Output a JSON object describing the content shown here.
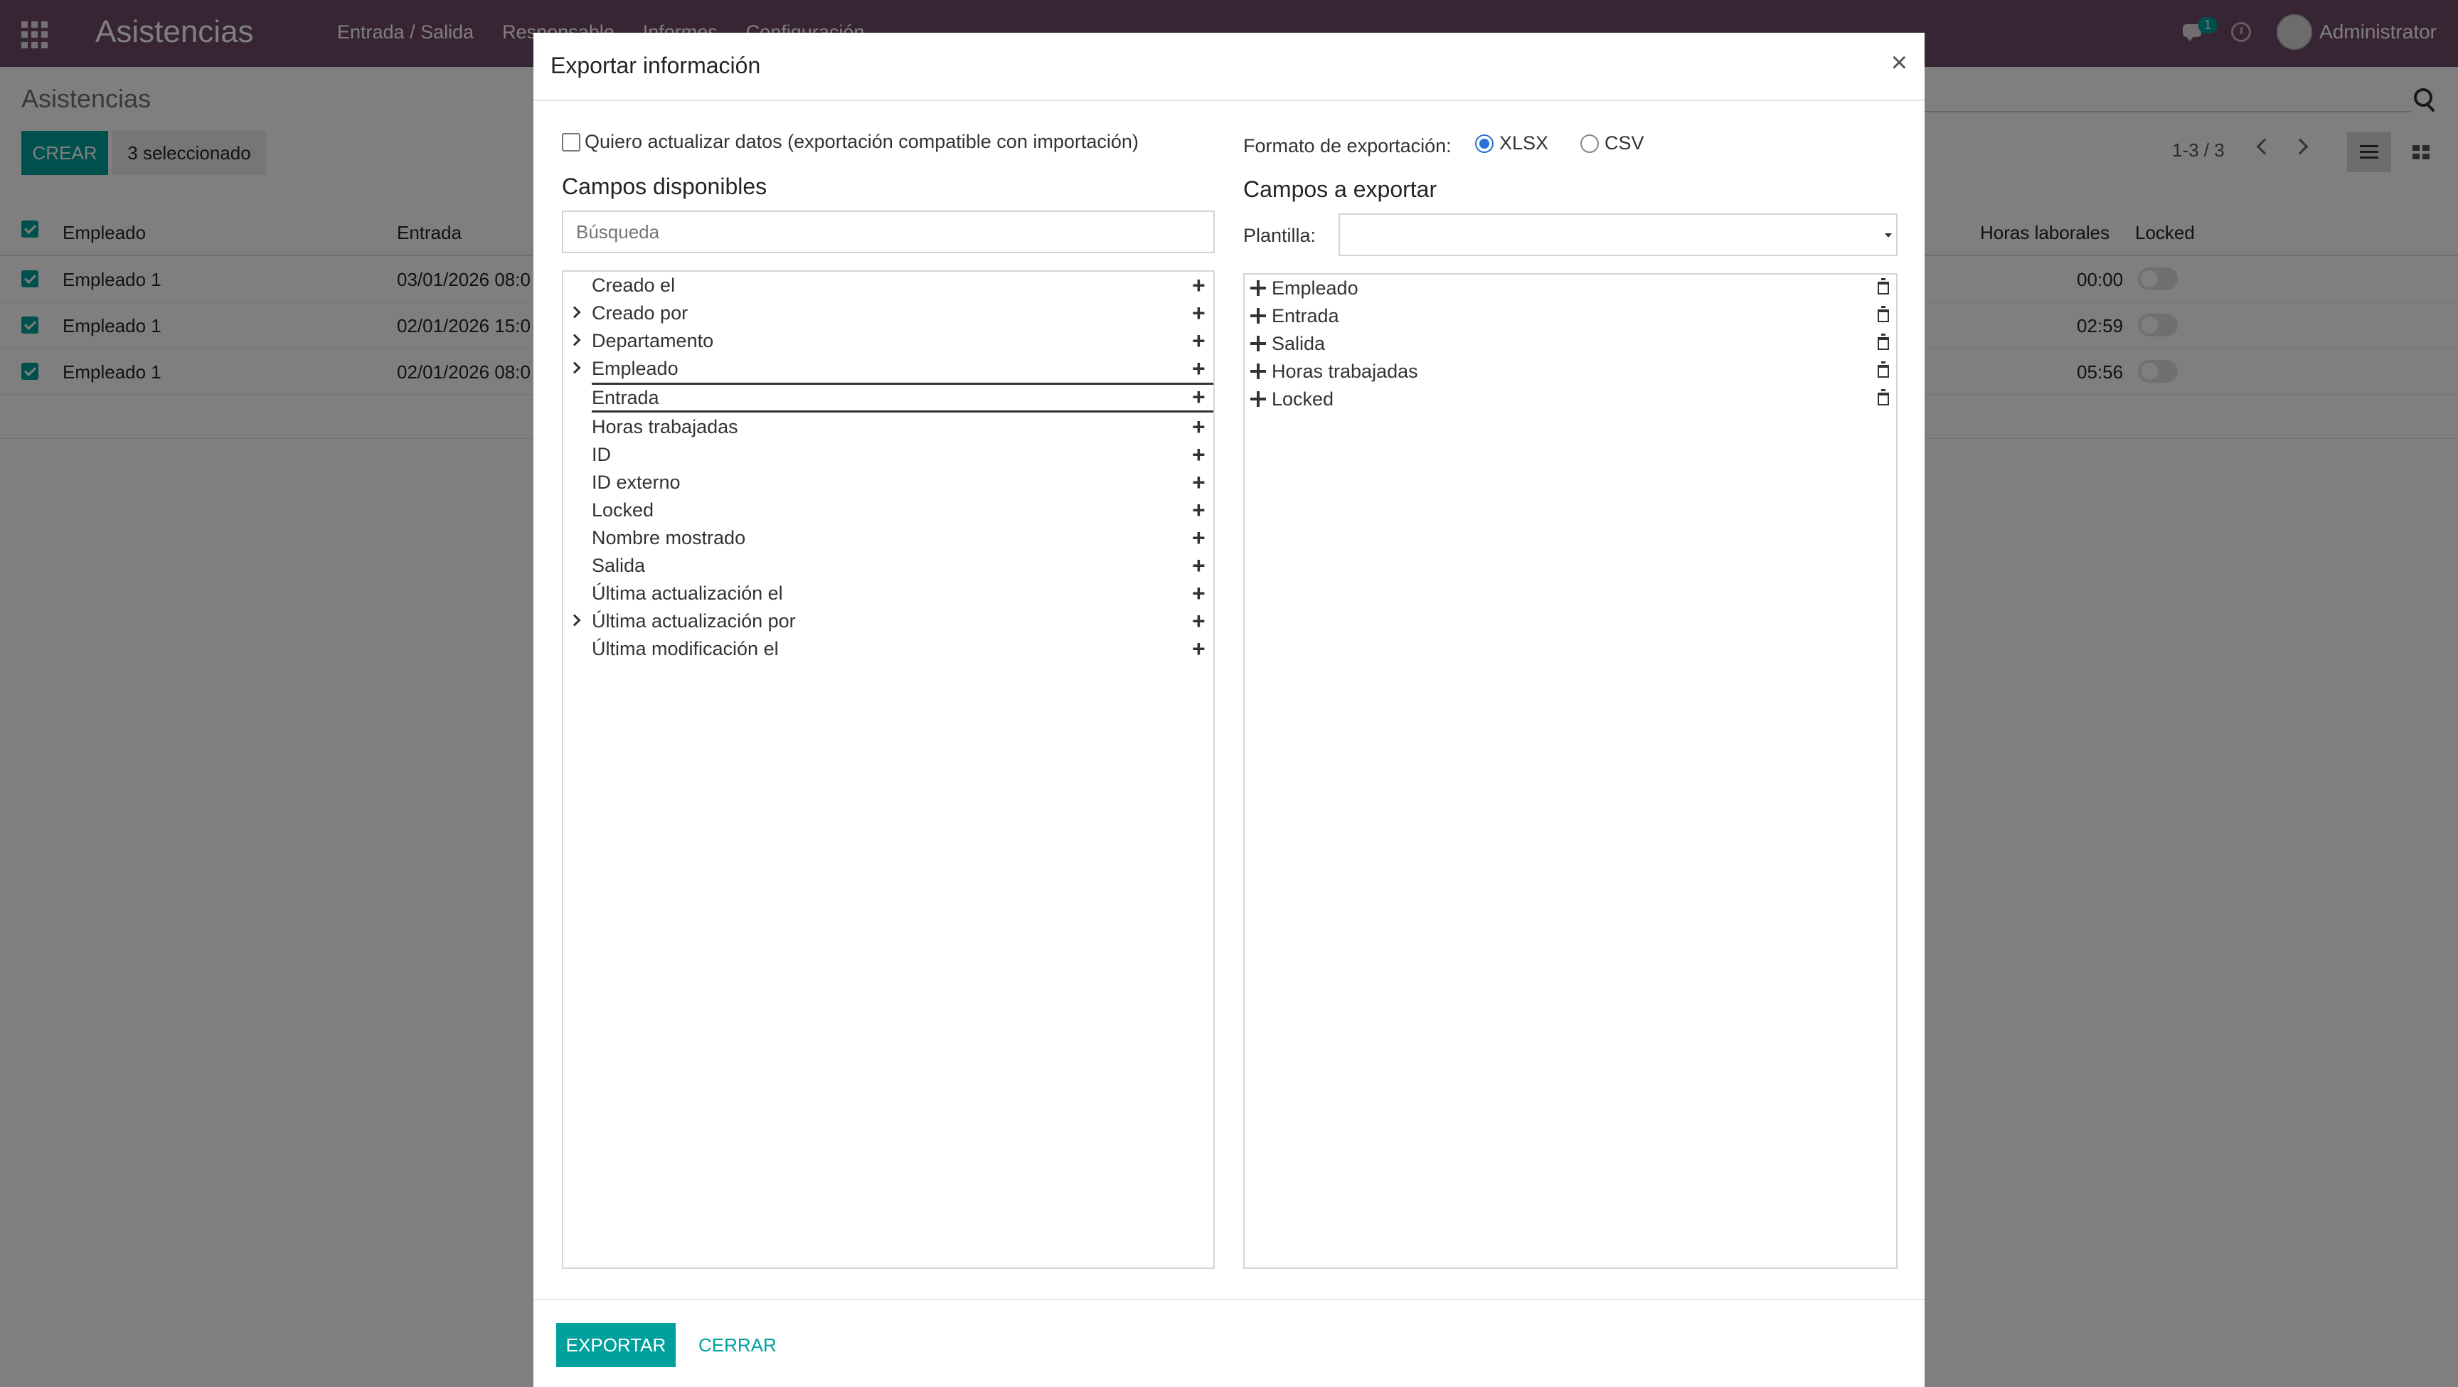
{
  "navbar": {
    "app_title": "Asistencias",
    "menu": [
      "Entrada / Salida",
      "Responsable",
      "Informes",
      "Configuración"
    ],
    "chat_badge": "1",
    "user_name": "Administrator"
  },
  "control_panel": {
    "title": "Asistencias",
    "create_label": "CREAR",
    "selected_label": "3 seleccionado",
    "pager": "1-3 / 3"
  },
  "list": {
    "headers": {
      "employee": "Empleado",
      "check_in": "Entrada",
      "worked_hours": "Horas laborales",
      "locked": "Locked"
    },
    "rows": [
      {
        "employee": "Empleado 1",
        "check_in": "03/01/2026 08:0",
        "worked_hours": "00:00"
      },
      {
        "employee": "Empleado 1",
        "check_in": "02/01/2026 15:0",
        "worked_hours": "02:59"
      },
      {
        "employee": "Empleado 1",
        "check_in": "02/01/2026 08:0",
        "worked_hours": "05:56"
      }
    ]
  },
  "modal": {
    "title": "Exportar información",
    "close_symbol": "×",
    "import_compat_label": "Quiero actualizar datos (exportación compatible con importación)",
    "format_label": "Formato de exportación:",
    "format_options": [
      "XLSX",
      "CSV"
    ],
    "selected_format": "XLSX",
    "available_title": "Campos disponibles",
    "search_placeholder": "Búsqueda",
    "export_title": "Campos a exportar",
    "template_label": "Plantilla:",
    "template_value": "",
    "available_fields": [
      {
        "label": "Creado el",
        "expandable": false
      },
      {
        "label": "Creado por",
        "expandable": true
      },
      {
        "label": "Departamento",
        "expandable": true
      },
      {
        "label": "Empleado",
        "expandable": true
      },
      {
        "label": "Entrada",
        "expandable": false
      },
      {
        "label": "Horas trabajadas",
        "expandable": false
      },
      {
        "label": "ID",
        "expandable": false
      },
      {
        "label": "ID externo",
        "expandable": false
      },
      {
        "label": "Locked",
        "expandable": false
      },
      {
        "label": "Nombre mostrado",
        "expandable": false
      },
      {
        "label": "Salida",
        "expandable": false
      },
      {
        "label": "Última actualización el",
        "expandable": false
      },
      {
        "label": "Última actualización por",
        "expandable": true
      },
      {
        "label": "Última modificación el",
        "expandable": false
      }
    ],
    "export_fields": [
      "Empleado",
      "Entrada",
      "Salida",
      "Horas trabajadas",
      "Locked"
    ],
    "export_button": "EXPORTAR",
    "close_button": "CERRAR"
  },
  "colors": {
    "navbar": "#714B67",
    "primary": "#00A09D"
  }
}
